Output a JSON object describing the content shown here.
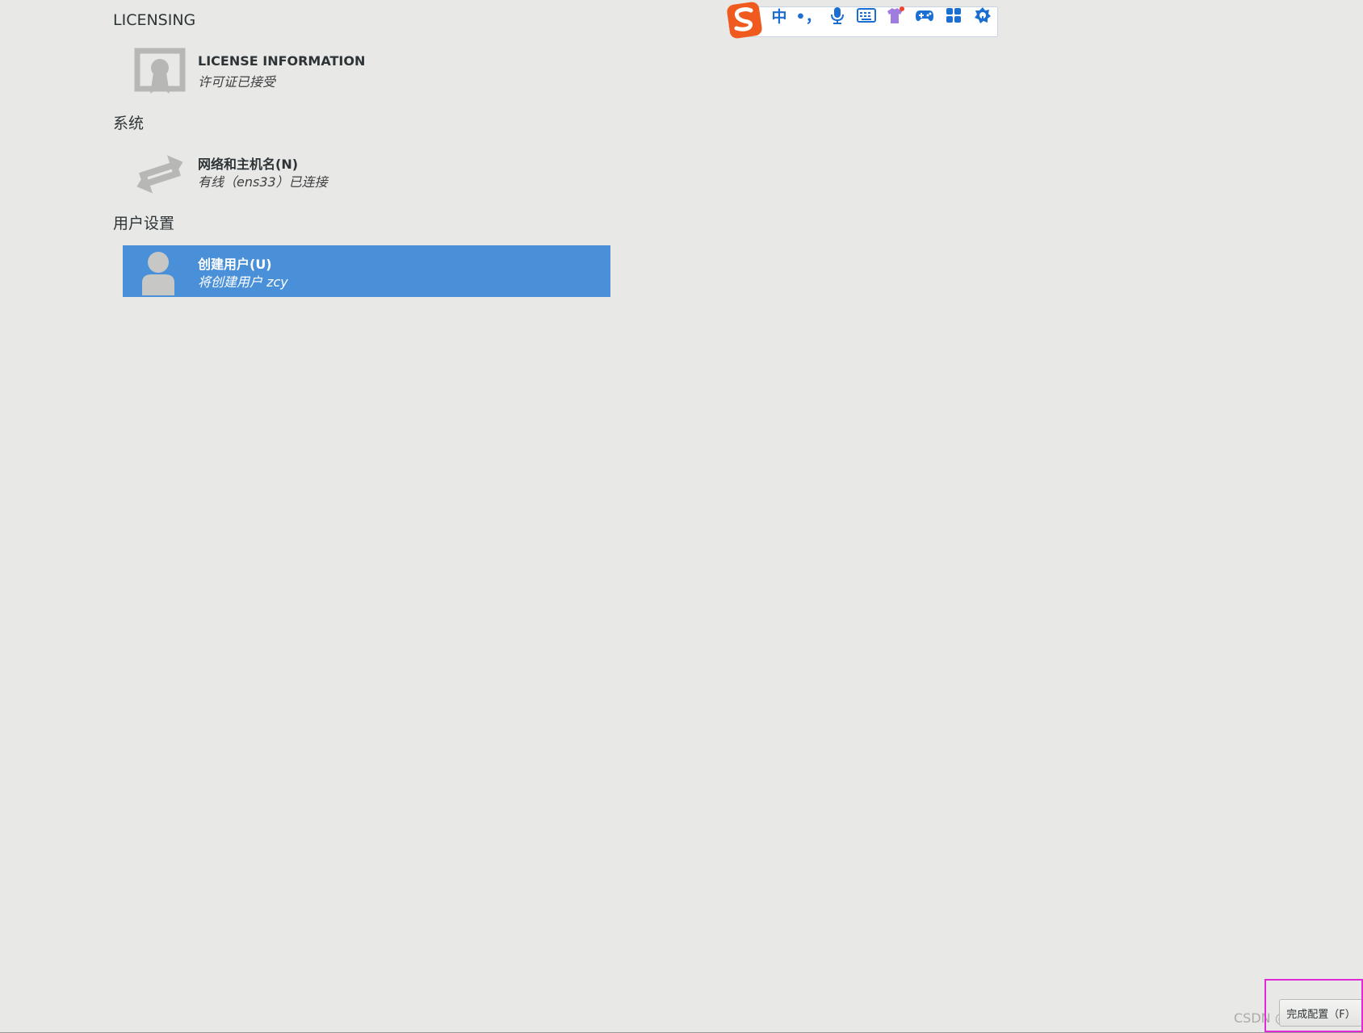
{
  "sections": {
    "licensing": "LICENSING",
    "system": "系统",
    "user_settings": "用户设置"
  },
  "spokes": {
    "license": {
      "title": "LICENSE INFORMATION",
      "status": "许可证已接受",
      "icon": "certificate-icon"
    },
    "network": {
      "title": "网络和主机名(N)",
      "status": "有线（ens33）已连接",
      "icon": "network-arrows-icon"
    },
    "user": {
      "title": "创建用户(U)",
      "status": "将创建用户 zcy",
      "icon": "user-avatar-icon"
    }
  },
  "ime_toolbar": {
    "logo": "sogou-logo-icon",
    "chinese_mode_label": "中",
    "punctuation_label": "•，",
    "buttons": [
      "voice-input-icon",
      "keyboard-icon",
      "skin-icon",
      "game-icon",
      "toolbox-icon",
      "settings-icon"
    ]
  },
  "footer": {
    "finish_button_label": "完成配置（F）",
    "watermark": "CSDN @张一只zcy"
  },
  "colors": {
    "background": "#e8e8e7",
    "selected_row": "#4a90d9",
    "ime_accent": "#1a6fd1",
    "highlight_box": "#e02ad6"
  }
}
